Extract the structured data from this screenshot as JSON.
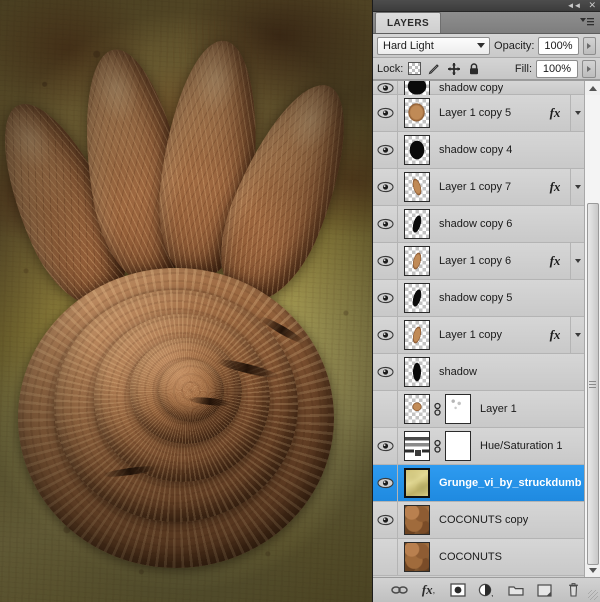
{
  "window": {
    "collapse_icon": "collapse-to-icons",
    "close_icon": "close-panel"
  },
  "panel": {
    "tab_label": "LAYERS",
    "menu_icon": "panel-menu-icon"
  },
  "blending": {
    "mode_value": "Hard Light",
    "opacity_label": "Opacity:",
    "opacity_value": "100%",
    "fill_label": "Fill:",
    "fill_value": "100%"
  },
  "lock": {
    "label": "Lock:",
    "icons": [
      "lock-transparent-pixels-icon",
      "lock-image-pixels-icon",
      "lock-position-icon",
      "lock-all-icon"
    ]
  },
  "layers": [
    {
      "name": "shadow copy",
      "visible": true,
      "clipped": true,
      "thumb": "tn-blob-dark-wide",
      "has_fx": false,
      "has_expand": false
    },
    {
      "name": "Layer 1 copy 5",
      "visible": true,
      "thumb": "tn-coco-blob",
      "has_fx": true,
      "fx_label": "fx",
      "has_expand": true
    },
    {
      "name": "shadow copy 4",
      "visible": true,
      "thumb": "tn-blob-dark",
      "has_fx": false,
      "has_expand": false
    },
    {
      "name": "Layer 1 copy 7",
      "visible": true,
      "thumb": "tn-pod-small-r",
      "has_fx": true,
      "fx_label": "fx",
      "has_expand": true
    },
    {
      "name": "shadow copy 6",
      "visible": true,
      "thumb": "tn-streak-dark-tilt",
      "has_fx": false,
      "has_expand": false
    },
    {
      "name": "Layer 1 copy 6",
      "visible": true,
      "thumb": "tn-pod-small",
      "has_fx": true,
      "fx_label": "fx",
      "has_expand": true
    },
    {
      "name": "shadow copy 5",
      "visible": true,
      "thumb": "tn-streak-dark-tilt",
      "has_fx": false,
      "has_expand": false
    },
    {
      "name": "Layer 1 copy",
      "visible": true,
      "thumb": "tn-pod-small",
      "has_fx": true,
      "fx_label": "fx",
      "has_expand": true
    },
    {
      "name": "shadow",
      "visible": true,
      "thumb": "tn-streak-dark",
      "has_fx": false,
      "has_expand": false
    },
    {
      "name": "Layer 1",
      "visible": false,
      "thumb": "tn-coco-dot",
      "mask_thumb": "tn-mask-dots",
      "linked": true,
      "has_fx": false,
      "has_expand": false
    },
    {
      "name": "Hue/Saturation 1",
      "visible": true,
      "thumb": "tn-huesat",
      "mask_thumb": "tn-white",
      "linked": true,
      "has_fx": false,
      "has_expand": false
    },
    {
      "name": "Grunge_vi_by_struckdumb",
      "visible": true,
      "thumb": "tn-grunge",
      "selected": true,
      "has_fx": false,
      "has_expand": false
    },
    {
      "name": "COCONUTS copy",
      "visible": true,
      "thumb": "tn-coconuts",
      "has_fx": false,
      "has_expand": false
    },
    {
      "name": "COCONUTS",
      "visible": false,
      "thumb": "tn-coconuts",
      "has_fx": false,
      "has_expand": false
    }
  ],
  "footer": {
    "buttons": [
      {
        "icon": "link-layers-icon"
      },
      {
        "icon": "add-layer-style-fx-icon",
        "label": "fx"
      },
      {
        "icon": "add-layer-mask-icon"
      },
      {
        "icon": "new-adjustment-layer-icon"
      },
      {
        "icon": "new-group-icon"
      },
      {
        "icon": "new-layer-icon"
      },
      {
        "icon": "delete-layer-trash-icon"
      }
    ],
    "resize_grip": "panel-resize-grip"
  },
  "canvas": {
    "title": "coconut-spiral-artwork",
    "description": "Four textured seed pods above a coiled brown spiral on a grunge background"
  },
  "colors": {
    "selection_blue": "#2e9bf0",
    "panel_bg": "#d4d4d4",
    "row_bg": "#d0d0d0",
    "titlebar": "#3c3c3c"
  }
}
